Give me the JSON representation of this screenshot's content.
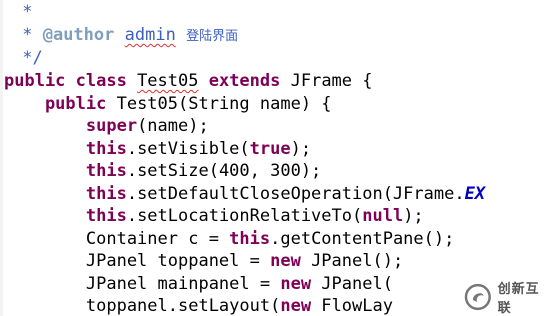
{
  "editor": {
    "lines": [
      {
        "segments": [
          {
            "text": " *",
            "cls": "jd"
          }
        ]
      },
      {
        "segments": [
          {
            "text": " * ",
            "cls": "jd"
          },
          {
            "text": "@author",
            "cls": "tag"
          },
          {
            "text": " ",
            "cls": "jd"
          },
          {
            "text": "admin",
            "cls": "jd squig"
          },
          {
            "text": " ",
            "cls": "jd"
          },
          {
            "text": "登陆界面",
            "cls": "cjk"
          }
        ]
      },
      {
        "segments": [
          {
            "text": " */",
            "cls": "jd"
          }
        ]
      },
      {
        "segments": [
          {
            "text": "public class ",
            "cls": "kw"
          },
          {
            "text": "Test05",
            "cls": "pl squig"
          },
          {
            "text": " extends ",
            "cls": "kw"
          },
          {
            "text": "JFrame {",
            "cls": "pl"
          }
        ]
      },
      {
        "segments": [
          {
            "text": "    public ",
            "cls": "kw"
          },
          {
            "text": "Test05(String name) {",
            "cls": "pl"
          }
        ]
      },
      {
        "segments": [
          {
            "text": "        super",
            "cls": "kw"
          },
          {
            "text": "(name);",
            "cls": "pl"
          }
        ]
      },
      {
        "segments": [
          {
            "text": "        this",
            "cls": "kw"
          },
          {
            "text": ".setVisible(",
            "cls": "pl"
          },
          {
            "text": "true",
            "cls": "kw"
          },
          {
            "text": ");",
            "cls": "pl"
          }
        ]
      },
      {
        "segments": [
          {
            "text": "        this",
            "cls": "kw"
          },
          {
            "text": ".setSize(400, 300);",
            "cls": "pl"
          }
        ]
      },
      {
        "segments": [
          {
            "text": "        this",
            "cls": "kw"
          },
          {
            "text": ".setDefaultCloseOperation(JFrame.",
            "cls": "pl"
          },
          {
            "text": "EX",
            "cls": "fld"
          }
        ]
      },
      {
        "segments": [
          {
            "text": "        this",
            "cls": "kw"
          },
          {
            "text": ".setLocationRelativeTo(",
            "cls": "pl"
          },
          {
            "text": "null",
            "cls": "kw"
          },
          {
            "text": ");",
            "cls": "pl"
          }
        ]
      },
      {
        "segments": [
          {
            "text": "        Container c = ",
            "cls": "pl"
          },
          {
            "text": "this",
            "cls": "kw"
          },
          {
            "text": ".getContentPane();",
            "cls": "pl"
          }
        ]
      },
      {
        "segments": [
          {
            "text": "        JPanel toppanel = ",
            "cls": "pl"
          },
          {
            "text": "new",
            "cls": "kw"
          },
          {
            "text": " JPanel();",
            "cls": "pl"
          }
        ]
      },
      {
        "segments": [
          {
            "text": "        JPanel mainpanel = ",
            "cls": "pl"
          },
          {
            "text": "new",
            "cls": "kw"
          },
          {
            "text": " JPanel(",
            "cls": "pl"
          }
        ]
      },
      {
        "segments": [
          {
            "text": "        toppanel.setLayout(",
            "cls": "pl"
          },
          {
            "text": "new",
            "cls": "kw"
          },
          {
            "text": " FlowLay",
            "cls": "pl"
          }
        ]
      }
    ]
  },
  "colors": {
    "keyword": "#7f0055",
    "javadoc": "#3f5fbf",
    "javadoc_tag": "#7f9fbf",
    "static_field": "#0000c0",
    "spelling_squiggle": "#e03030"
  },
  "watermark": {
    "text": "创新互联",
    "logo_icon": "cx-logo-icon"
  }
}
